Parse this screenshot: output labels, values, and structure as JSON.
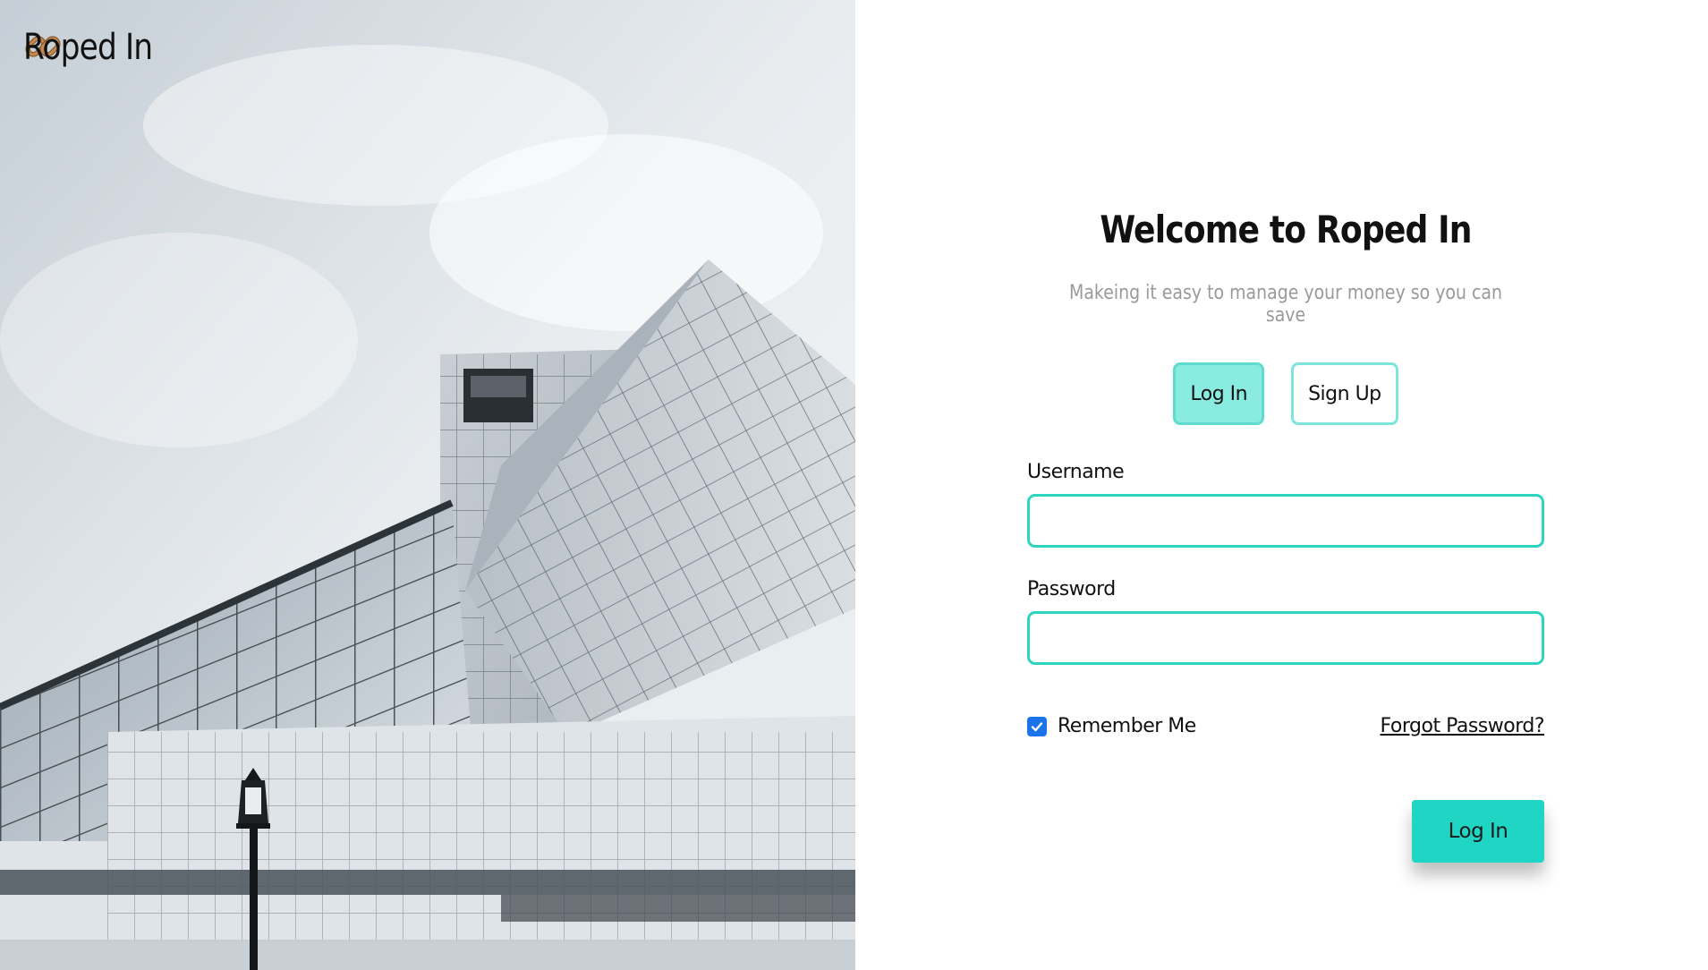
{
  "brand": {
    "name": "Roped In",
    "icon": "chain-link-icon"
  },
  "hero": {
    "image": "modern-glass-building-photo"
  },
  "login": {
    "title": "Welcome to Roped In",
    "tagline": "Makeing it easy to manage your money so you can save",
    "tabs": [
      {
        "label": "Log In",
        "active": true
      },
      {
        "label": "Sign Up",
        "active": false
      }
    ],
    "username": {
      "label": "Username",
      "value": "",
      "placeholder": ""
    },
    "password": {
      "label": "Password",
      "value": "",
      "placeholder": ""
    },
    "remember": {
      "label": "Remember Me",
      "checked": true
    },
    "forgot_label": "Forgot Password?",
    "submit_label": "Log In"
  },
  "colors": {
    "accent": "#1fd6c4",
    "accent_light": "#8aebe0",
    "input_border": "#2dd4bf",
    "checkbox": "#1a73e8",
    "brand_icon": "#b07a45"
  }
}
